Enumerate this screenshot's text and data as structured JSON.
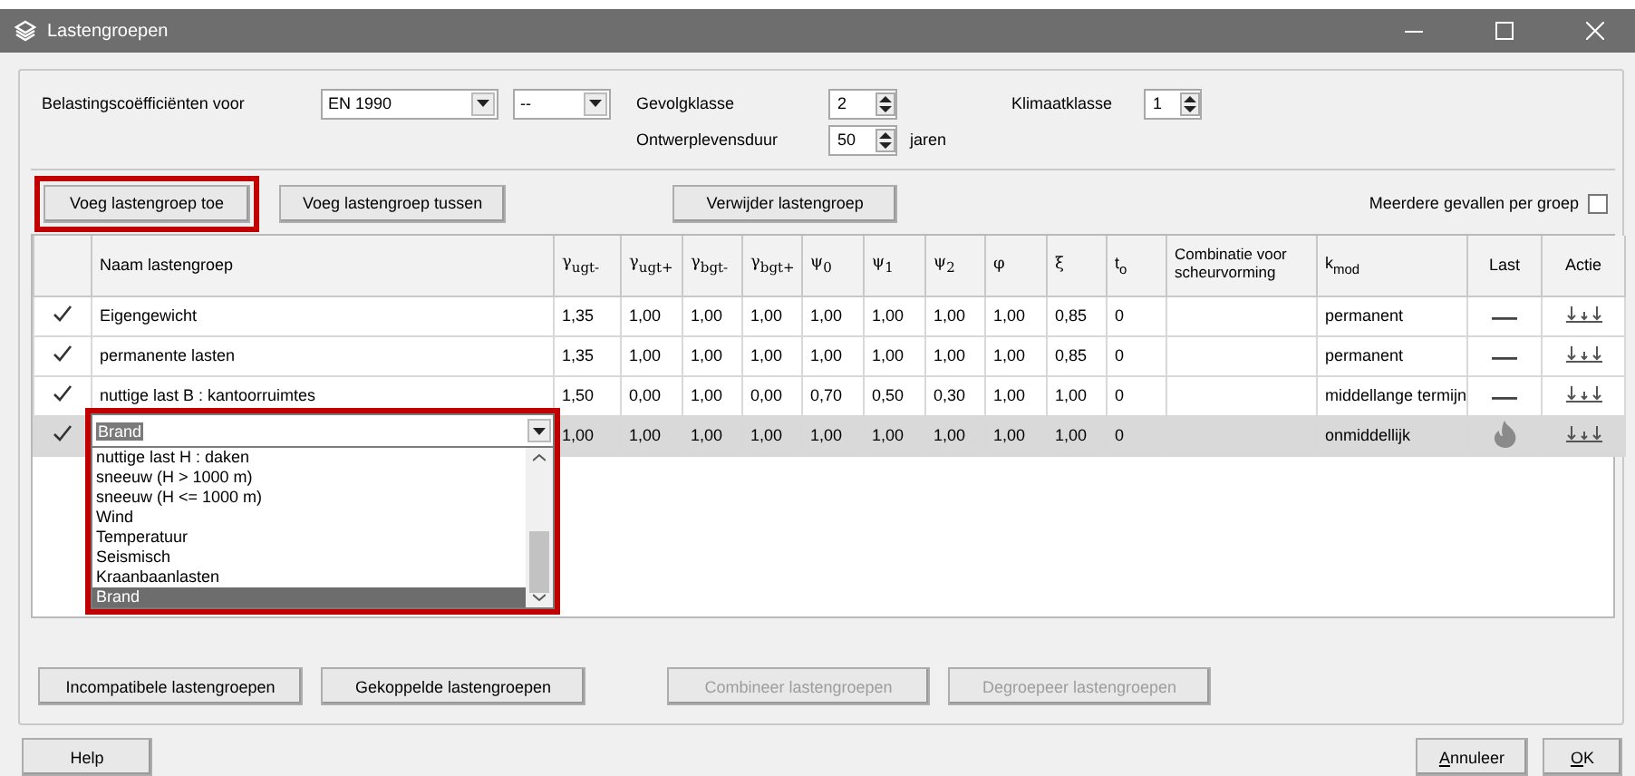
{
  "window": {
    "title": "Lastengroepen"
  },
  "settings": {
    "coefficients": {
      "label": "Belastingscoëfficiënten voor",
      "standard": "EN 1990",
      "variant": "--"
    },
    "consequence_class": {
      "label": "Gevolgklasse",
      "value": "2"
    },
    "design_life": {
      "label": "Ontwerplevensduur",
      "value": "50",
      "unit": "jaren"
    },
    "climate_class": {
      "label": "Klimaatklasse",
      "value": "1"
    }
  },
  "toolbar": {
    "left": [
      {
        "label": "Voeg lastengroep toe",
        "highlighted": true
      },
      {
        "label": "Voeg lastengroep tussen",
        "highlighted": false
      }
    ],
    "middle": [
      {
        "label": "Verwijder lastengroep",
        "highlighted": false
      }
    ]
  },
  "multiple_cases": {
    "label": "Meerdere gevallen per groep",
    "checked": false
  },
  "table": {
    "columns": [
      "",
      "Naam lastengroep",
      "γ$_{ugt-}$",
      "γ$_{ugt+}$",
      "γ$_{bgt-}$",
      "γ$_{bgt+}$",
      "ψ$_{0}$",
      "ψ$_{1}$",
      "ψ$_{2}$",
      "φ",
      "ξ",
      "t$_{o}$",
      "Combinatie voor scheurvorming",
      "k$_{mod}$",
      "Last",
      "Actie"
    ],
    "rows": [
      {
        "checked": true,
        "selected": false,
        "name": "Eigengewicht",
        "values": [
          "1,35",
          "1,00",
          "1,00",
          "1,00",
          "1,00",
          "1,00",
          "1,00",
          "1,00",
          "0,85",
          "0"
        ],
        "kmod": "permanent",
        "fire": false
      },
      {
        "checked": true,
        "selected": false,
        "name": "permanente lasten",
        "values": [
          "1,35",
          "1,00",
          "1,00",
          "1,00",
          "1,00",
          "1,00",
          "1,00",
          "1,00",
          "0,85",
          "0"
        ],
        "kmod": "permanent",
        "fire": false
      },
      {
        "checked": true,
        "selected": false,
        "name": "nuttige last B : kantoorruimtes",
        "values": [
          "1,50",
          "0,00",
          "1,00",
          "0,00",
          "0,70",
          "0,50",
          "0,30",
          "1,00",
          "1,00",
          "0"
        ],
        "kmod": "middellange termijn",
        "fire": false
      },
      {
        "checked": true,
        "selected": true,
        "name_editor": {
          "value": "Brand",
          "highlighted": true,
          "options": [
            {
              "label": "nuttige last H : daken",
              "selected": false
            },
            {
              "label": "sneeuw (H > 1000 m)",
              "selected": false
            },
            {
              "label": "sneeuw (H <= 1000 m)",
              "selected": false
            },
            {
              "label": "Wind",
              "selected": false
            },
            {
              "label": "Temperatuur",
              "selected": false
            },
            {
              "label": "Seismisch",
              "selected": false
            },
            {
              "label": "Kraanbaanlasten",
              "selected": false
            },
            {
              "label": "Brand",
              "selected": true
            }
          ]
        },
        "values": [
          "1,00",
          "1,00",
          "1,00",
          "1,00",
          "1,00",
          "1,00",
          "1,00",
          "1,00",
          "1,00",
          "0"
        ],
        "kmod": "onmiddellijk",
        "fire": true
      }
    ]
  },
  "group_buttons": [
    {
      "label": "Incompatibele lastengroepen",
      "disabled": false
    },
    {
      "label": "Gekoppelde lastengroepen",
      "disabled": false
    },
    {
      "label": "Combineer lastengroepen",
      "disabled": true
    },
    {
      "label": "Degroepeer lastengroepen",
      "disabled": true
    }
  ],
  "footer": {
    "left": [
      {
        "label": "Help",
        "access_key": false
      }
    ],
    "right": [
      {
        "label": "Annuleer",
        "access_key": true
      },
      {
        "label": "OK",
        "access_key": true
      }
    ]
  }
}
